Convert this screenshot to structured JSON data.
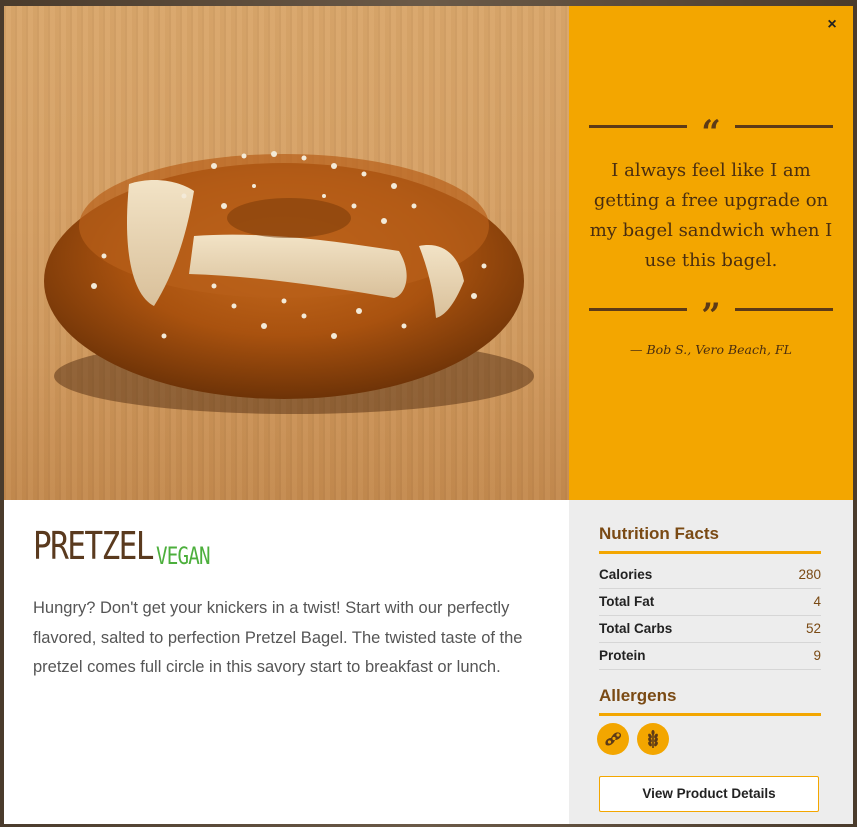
{
  "modal": {
    "close_label": "×"
  },
  "quote": {
    "open_mark": "“",
    "close_mark": "”",
    "text": "I always feel like I am getting a free upgrade on my bagel sandwich when I use this bagel.",
    "author": "— Bob S., Vero Beach, FL"
  },
  "product": {
    "name": "PRETZEL",
    "tag": "VEGAN",
    "description": "Hungry? Don't get your knickers in a twist! Start with our perfectly flavored, salted to perfection Pretzel Bagel. The twisted taste of the pretzel comes full circle in this savory start to breakfast or lunch."
  },
  "nutrition": {
    "heading": "Nutrition Facts",
    "rows": [
      {
        "label": "Calories",
        "value": "280"
      },
      {
        "label": "Total Fat",
        "value": "4"
      },
      {
        "label": "Total Carbs",
        "value": "52"
      },
      {
        "label": "Protein",
        "value": "9"
      }
    ],
    "allergens_heading": "Allergens",
    "allergens": [
      {
        "icon": "soy-icon"
      },
      {
        "icon": "wheat-icon"
      }
    ],
    "details_button": "View Product Details"
  },
  "colors": {
    "accent": "#f3a600",
    "brown": "#5c3a17",
    "vegan_green": "#4caf3c"
  }
}
